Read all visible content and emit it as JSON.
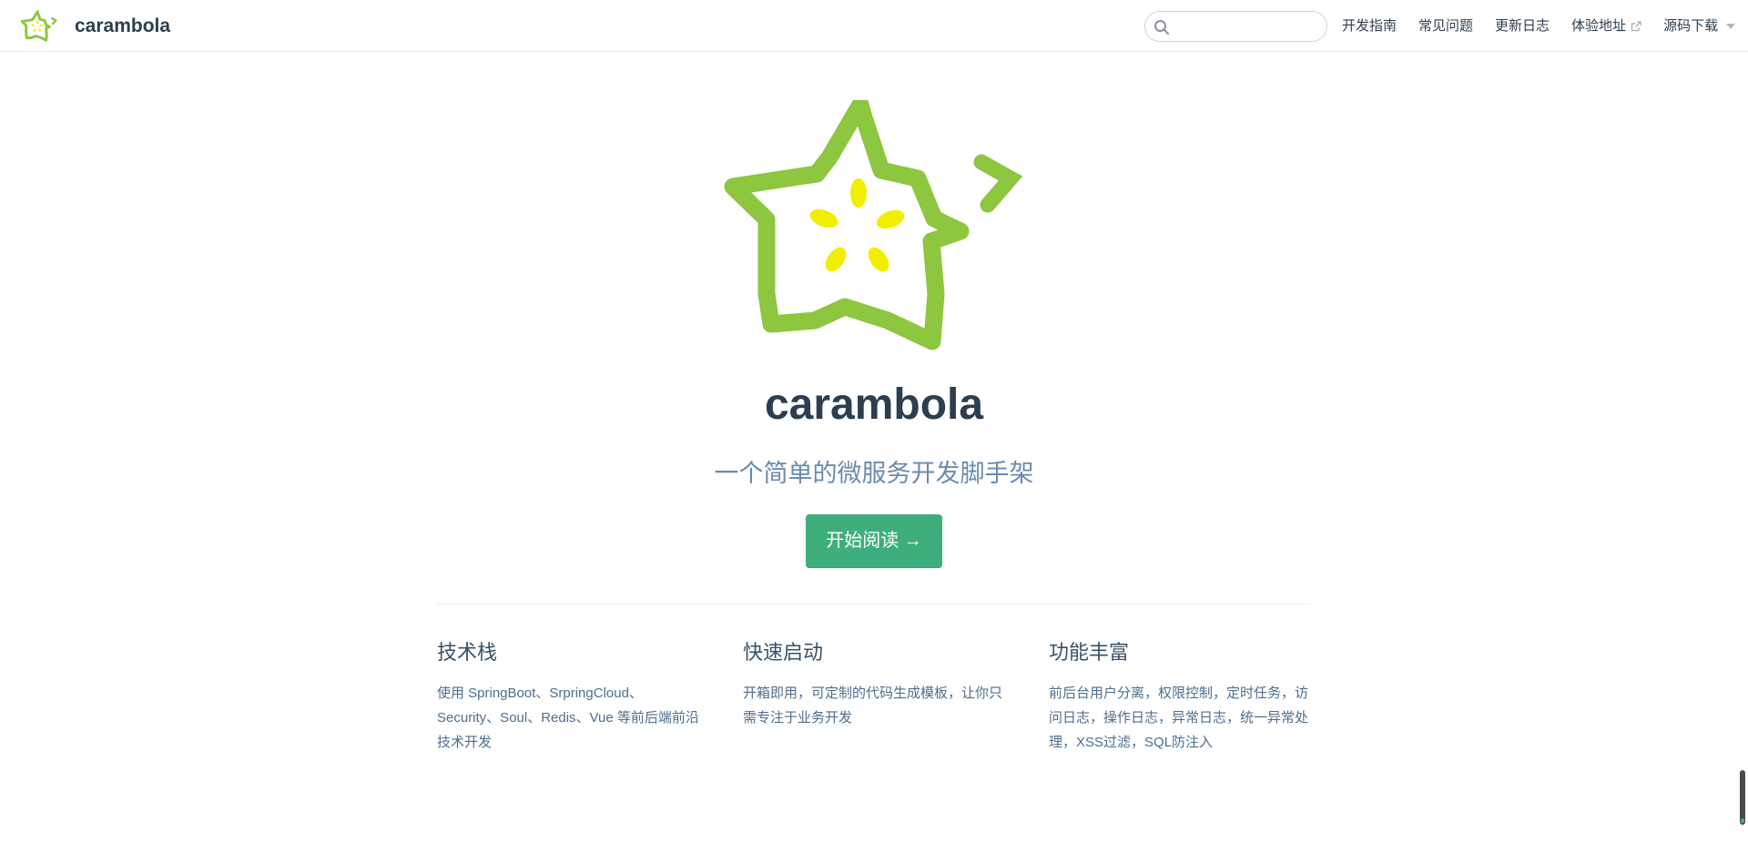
{
  "header": {
    "site_name": "carambola",
    "logo_icon": "carambola-star-logo",
    "search": {
      "placeholder": "",
      "value": ""
    },
    "nav": [
      {
        "label": "开发指南"
      },
      {
        "label": "常见问题"
      },
      {
        "label": "更新日志"
      },
      {
        "label": "体验地址",
        "external": true
      },
      {
        "label": "源码下载",
        "dropdown": true
      }
    ]
  },
  "hero": {
    "title": "carambola",
    "description": "一个简单的微服务开发脚手架",
    "action_label": "开始阅读 →"
  },
  "features": [
    {
      "title": "技术栈",
      "details": "使用 SpringBoot、SrpringCloud、Security、Soul、Redis、Vue 等前后端前沿技术开发"
    },
    {
      "title": "快速启动",
      "details": "开箱即用，可定制的代码生成模板，让你只需专注于业务开发"
    },
    {
      "title": "功能丰富",
      "details": "前后台用户分离，权限控制，定时任务，访问日志，操作日志，异常日志，统一异常处理，XSS过滤，SQL防注入"
    }
  ],
  "colors": {
    "accent": "#3eaf7c",
    "logo_green": "#8dc63f",
    "logo_yellow": "#f2ee00",
    "text": "#2c3e50",
    "description": "#6a8bad"
  }
}
